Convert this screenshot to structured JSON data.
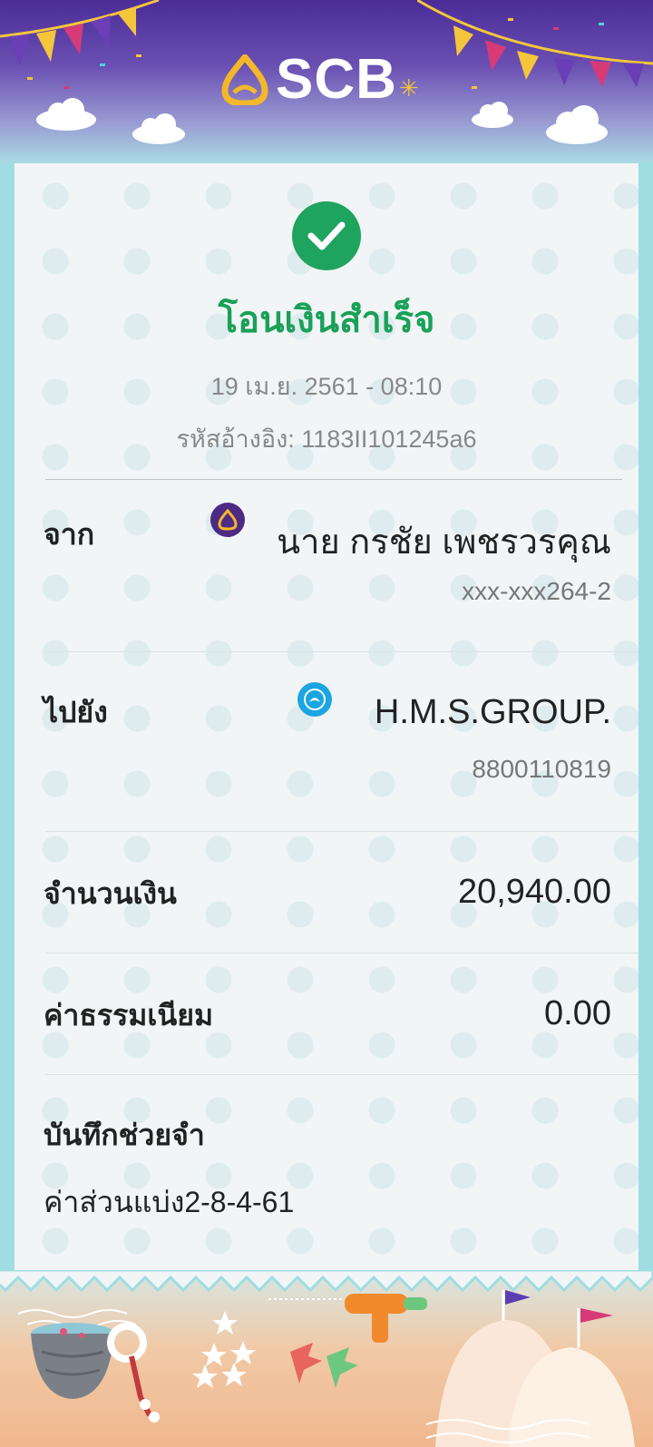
{
  "header": {
    "brand_name": "SCB",
    "brand_logo_icon": "scb-logo-icon",
    "colors": {
      "top": "#4b2c98",
      "bottom": "#a9dbe3"
    }
  },
  "receipt": {
    "status_icon": "check-circle-icon",
    "title": "โอนเงินสำเร็จ",
    "datetime": "19 เม.ย. 2561 - 08:10",
    "reference_label": "รหัสอ้างอิง:",
    "reference_value": "1183II101245a6",
    "accent_color": "#1aa058"
  },
  "from": {
    "label": "จาก",
    "bank_icon": "scb-bank-icon",
    "name": "นาย กรชัย เพชรวรคุณ",
    "account": "xxx-xxx264-2"
  },
  "to": {
    "label": "ไปยัง",
    "bank_icon": "ktb-bank-icon",
    "name": "H.M.S.GROUP.",
    "account": "8800110819"
  },
  "amount": {
    "label": "จำนวนเงิน",
    "value": "20,940.00"
  },
  "fee": {
    "label": "ค่าธรรมเนียม",
    "value": "0.00"
  },
  "memo": {
    "label": "บันทึกช่วยจำ",
    "value": "ค่าส่วนแบ่ง2-8-4-61"
  }
}
